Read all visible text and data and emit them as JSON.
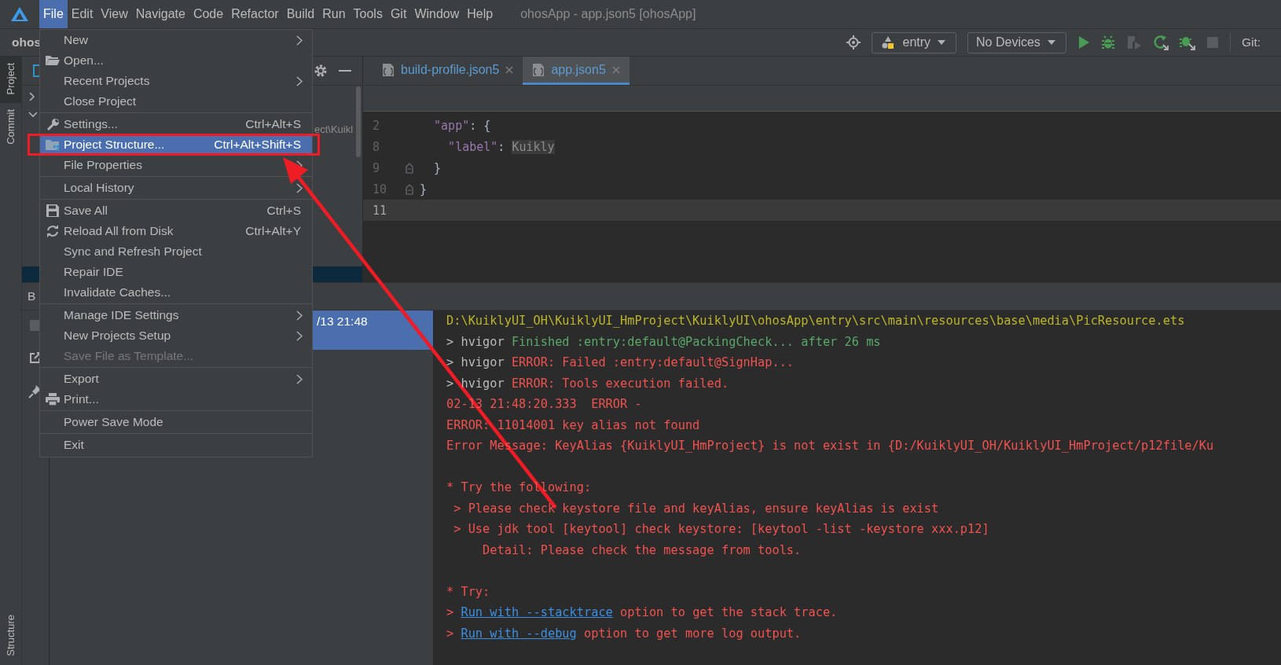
{
  "menubar": {
    "items": [
      {
        "label": "File",
        "selected": true
      },
      {
        "label": "Edit",
        "selected": false
      },
      {
        "label": "View",
        "selected": false
      },
      {
        "label": "Navigate",
        "selected": false
      },
      {
        "label": "Code",
        "selected": false
      },
      {
        "label": "Refactor",
        "selected": false
      },
      {
        "label": "Build",
        "selected": false
      },
      {
        "label": "Run",
        "selected": false
      },
      {
        "label": "Tools",
        "selected": false
      },
      {
        "label": "Git",
        "selected": false
      },
      {
        "label": "Window",
        "selected": false
      },
      {
        "label": "Help",
        "selected": false
      }
    ],
    "title": "ohosApp - app.json5 [ohosApp]"
  },
  "toolbar": {
    "project": "ohos",
    "configuration": "entry",
    "device": "No Devices",
    "git_label": "Git:"
  },
  "left_stripe": {
    "top": [
      {
        "label": "Project",
        "selected": true
      },
      {
        "label": "Commit",
        "selected": false
      }
    ],
    "bottom": [
      {
        "label": "Structure",
        "selected": false
      }
    ]
  },
  "project_panel": {
    "path_fragment": "ect\\Kuikl"
  },
  "editor": {
    "tabs": [
      {
        "label": "build-profile.json5",
        "selected": false
      },
      {
        "label": "app.json5",
        "selected": true
      }
    ],
    "lines": [
      {
        "number": "2",
        "current": false,
        "tokens": [
          {
            "text": "  \"app\"",
            "kind": "key"
          },
          {
            "text": ": {",
            "kind": "plain"
          }
        ]
      },
      {
        "number": "8",
        "current": false,
        "tokens": [
          {
            "text": "    \"label\"",
            "kind": "key"
          },
          {
            "text": ": ",
            "kind": "plain"
          },
          {
            "text": "Kuikly",
            "kind": "match"
          }
        ]
      },
      {
        "number": "9",
        "current": false,
        "tokens": [
          {
            "text": "  }",
            "kind": "plain"
          }
        ]
      },
      {
        "number": "10",
        "current": false,
        "tokens": [
          {
            "text": "}",
            "kind": "plain"
          }
        ]
      },
      {
        "number": "11",
        "current": true
      }
    ]
  },
  "build_panel": {
    "title": "B",
    "selected_run": "/13 21:48",
    "console": [
      {
        "kind": "text",
        "segments": [
          {
            "text": "D:\\KuiklyUI_OH\\KuiklyUI_HmProject\\KuiklyUI\\ohosApp\\entry\\src\\main\\resources\\base\\media\\PicResource.ets",
            "kind": "path"
          }
        ]
      },
      {
        "kind": "text",
        "segments": [
          {
            "text": "> hvigor ",
            "kind": "plain"
          },
          {
            "text": "Finished :entry:default@PackingCheck... after 26 ms",
            "kind": "success"
          }
        ]
      },
      {
        "kind": "text",
        "segments": [
          {
            "text": "> hvigor ",
            "kind": "plain"
          },
          {
            "text": "ERROR: Failed :entry:default@SignHap...",
            "kind": "error"
          }
        ]
      },
      {
        "kind": "text",
        "segments": [
          {
            "text": "> hvigor ",
            "kind": "plain"
          },
          {
            "text": "ERROR: Tools execution failed.",
            "kind": "error"
          }
        ]
      },
      {
        "kind": "text",
        "segments": [
          {
            "text": "02-13 21:48:20.333  ERROR -",
            "kind": "error"
          }
        ]
      },
      {
        "kind": "text",
        "segments": [
          {
            "text": "ERROR: 11014001 key alias not found",
            "kind": "error"
          }
        ]
      },
      {
        "kind": "text",
        "segments": [
          {
            "text": "Error Message: KeyAlias {KuiklyUI_HmProject} is not exist in {D:/KuiklyUI_OH/KuiklyUI_HmProject/p12file/Ku",
            "kind": "error"
          }
        ]
      },
      {
        "kind": "blank"
      },
      {
        "kind": "text",
        "segments": [
          {
            "text": "* Try the following:",
            "kind": "error"
          }
        ]
      },
      {
        "kind": "text",
        "segments": [
          {
            "text": " > Please check keystore file and keyAlias, ensure keyAlias is exist",
            "kind": "error"
          }
        ]
      },
      {
        "kind": "text",
        "segments": [
          {
            "text": " > Use jdk tool [keytool] check keystore: [keytool -list -keystore xxx.p12]",
            "kind": "error"
          }
        ]
      },
      {
        "kind": "text",
        "segments": [
          {
            "text": "     Detail: Please check the message from tools.",
            "kind": "error"
          }
        ]
      },
      {
        "kind": "blank"
      },
      {
        "kind": "text",
        "segments": [
          {
            "text": "* Try:",
            "kind": "error"
          }
        ]
      },
      {
        "kind": "text",
        "segments": [
          {
            "text": "> ",
            "kind": "error"
          },
          {
            "text": "Run with --stacktrace",
            "kind": "link"
          },
          {
            "text": " option to get the stack trace.",
            "kind": "error"
          }
        ]
      },
      {
        "kind": "text",
        "segments": [
          {
            "text": "> ",
            "kind": "error"
          },
          {
            "text": "Run with --debug",
            "kind": "link"
          },
          {
            "text": " option to get more log output.",
            "kind": "error"
          }
        ]
      }
    ]
  },
  "file_menu": {
    "groups": [
      [
        {
          "label": "New",
          "submenu": true,
          "selected": false,
          "disabled": false
        },
        {
          "label": "Open...",
          "submenu": false,
          "selected": false,
          "disabled": false
        },
        {
          "label": "Recent Projects",
          "submenu": true,
          "selected": false,
          "disabled": false
        },
        {
          "label": "Close Project",
          "submenu": false,
          "selected": false,
          "disabled": false
        }
      ],
      [
        {
          "label": "Settings...",
          "shortcut": "Ctrl+Alt+S",
          "submenu": false,
          "selected": false,
          "disabled": false
        },
        {
          "label": "Project Structure...",
          "shortcut": "Ctrl+Alt+Shift+S",
          "submenu": false,
          "selected": true,
          "disabled": false
        },
        {
          "label": "File Properties",
          "submenu": true,
          "selected": false,
          "disabled": false
        }
      ],
      [
        {
          "label": "Local History",
          "submenu": true,
          "selected": false,
          "disabled": false
        }
      ],
      [
        {
          "label": "Save All",
          "shortcut": "Ctrl+S",
          "submenu": false,
          "selected": false,
          "disabled": false
        },
        {
          "label": "Reload All from Disk",
          "shortcut": "Ctrl+Alt+Y",
          "submenu": false,
          "selected": false,
          "disabled": false
        },
        {
          "label": "Sync and Refresh Project",
          "submenu": false,
          "selected": false,
          "disabled": false
        },
        {
          "label": "Repair IDE",
          "submenu": false,
          "selected": false,
          "disabled": false
        },
        {
          "label": "Invalidate Caches...",
          "submenu": false,
          "selected": false,
          "disabled": false
        }
      ],
      [
        {
          "label": "Manage IDE Settings",
          "submenu": true,
          "selected": false,
          "disabled": false
        },
        {
          "label": "New Projects Setup",
          "submenu": true,
          "selected": false,
          "disabled": false
        },
        {
          "label": "Save File as Template...",
          "submenu": false,
          "selected": false,
          "disabled": true
        }
      ],
      [
        {
          "label": "Export",
          "submenu": true,
          "selected": false,
          "disabled": false
        },
        {
          "label": "Print...",
          "submenu": false,
          "selected": false,
          "disabled": false
        }
      ],
      [
        {
          "label": "Power Save Mode",
          "submenu": false,
          "selected": false,
          "disabled": false
        }
      ],
      [
        {
          "label": "Exit",
          "submenu": false,
          "selected": false,
          "disabled": false
        }
      ]
    ]
  }
}
